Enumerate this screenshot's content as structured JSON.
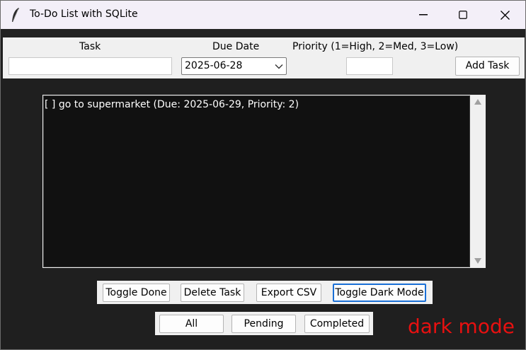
{
  "window": {
    "title": "To-Do List with SQLite",
    "icon": "feather-icon",
    "controls": [
      "minimize-icon",
      "maximize-icon",
      "close-icon"
    ]
  },
  "form": {
    "task_label": "Task",
    "task_value": "",
    "due_label": "Due Date",
    "due_value": "2025-06-28",
    "priority_label": "Priority (1=High, 2=Med, 3=Low)",
    "priority_value": "",
    "add_button": "Add Task"
  },
  "tasks": [
    {
      "text": "[ ] go to supermarket (Due: 2025-06-29, Priority: 2)"
    }
  ],
  "actions": {
    "toggle_done": "Toggle Done",
    "delete_task": "Delete Task",
    "export_csv": "Export CSV",
    "toggle_dark": "Toggle Dark Mode"
  },
  "filters": {
    "all": "All",
    "pending": "Pending",
    "completed": "Completed"
  },
  "annotation": "dark mode",
  "colors": {
    "background": "#1f1f1f",
    "listbox_bg": "#111111",
    "list_text": "#ffffff",
    "annotation": "#e81010",
    "focus_ring": "#1a6fd6"
  }
}
